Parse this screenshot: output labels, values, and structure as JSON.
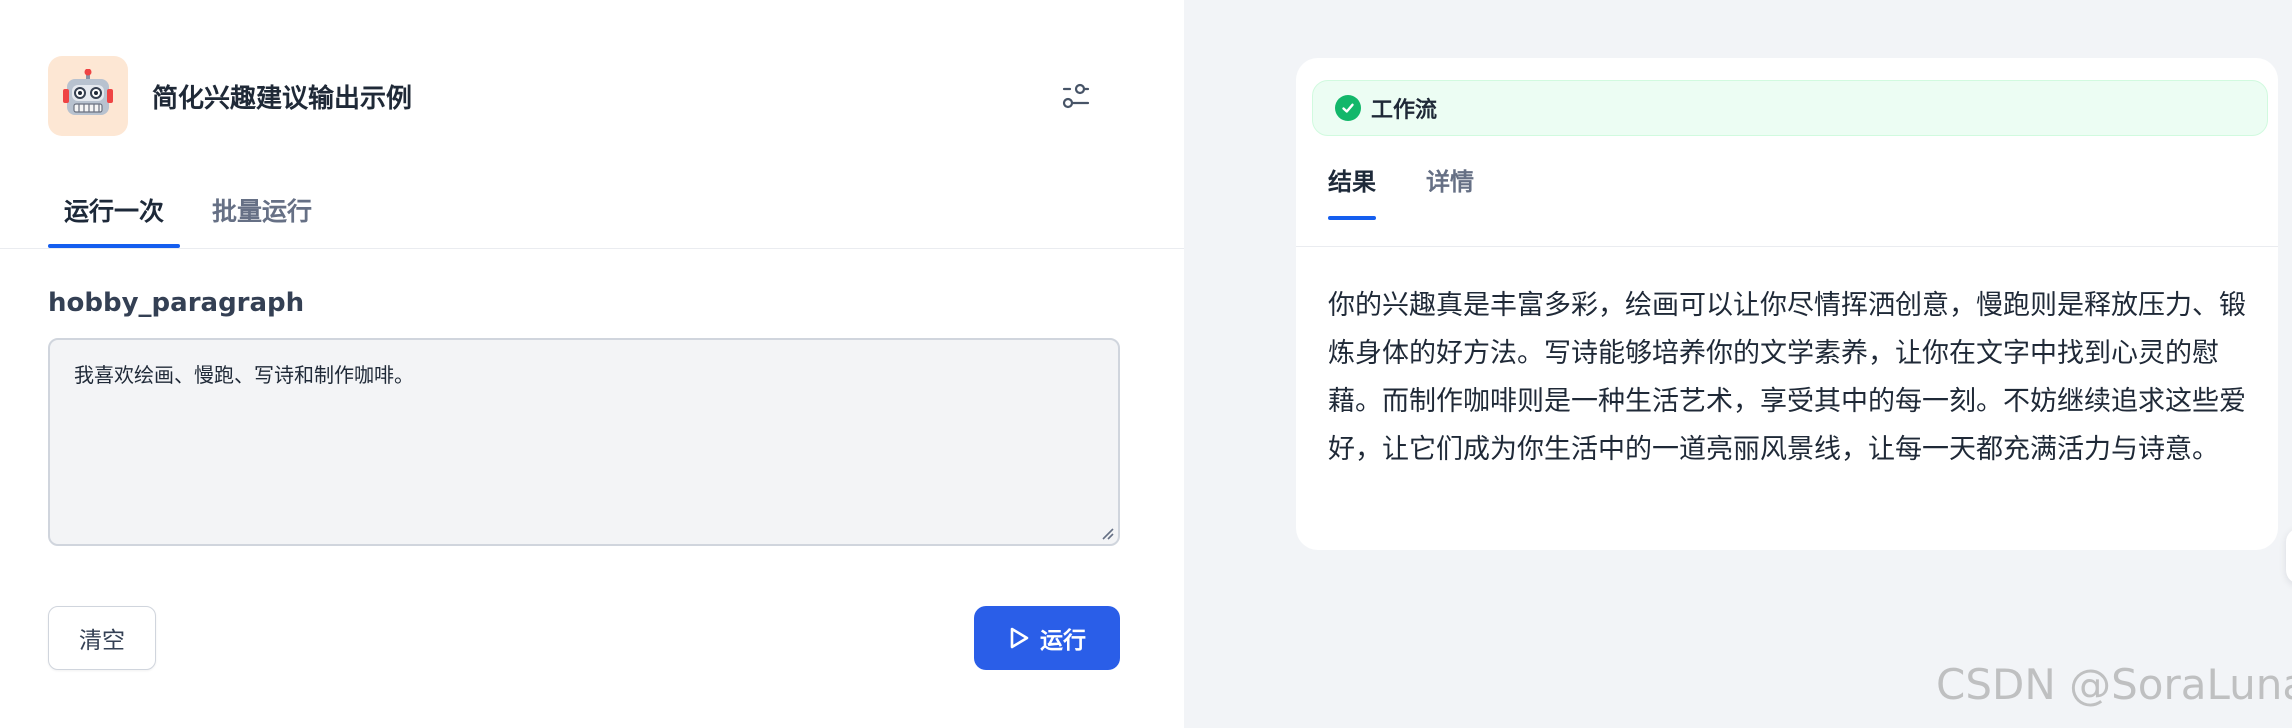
{
  "app": {
    "title": "简化兴趣建议输出示例",
    "icon": "robot-icon",
    "icon_bg": "#fde7d4"
  },
  "tabs": {
    "run_once": "运行一次",
    "batch_run": "批量运行"
  },
  "form": {
    "field_label": "hobby_paragraph",
    "field_value": "我喜欢绘画、慢跑、写诗和制作咖啡。"
  },
  "actions": {
    "clear_label": "清空",
    "run_label": "运行",
    "accent": "#2a5ee8"
  },
  "result": {
    "badge_label": "工作流",
    "badge_status_color": "#12b76a",
    "tab_result": "结果",
    "tab_detail": "详情",
    "text": "你的兴趣真是丰富多彩，绘画可以让你尽情挥洒创意，慢跑则是释放压力、锻炼身体的好方法。写诗能够培养你的文学素养，让你在文字中找到心灵的慰藉。而制作咖啡则是一种生活艺术，享受其中的每一刻。不妨继续追求这些爱好，让它们成为你生活中的一道亮丽风景线，让每一天都充满活力与诗意。"
  },
  "watermark": "CSDN @SoraLuna"
}
